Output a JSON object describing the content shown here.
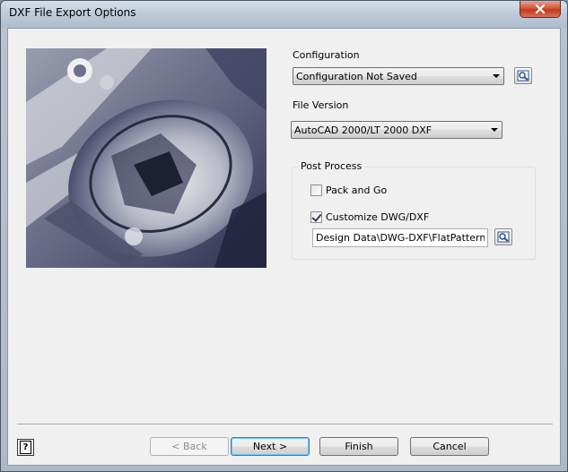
{
  "window": {
    "title": "DXF File Export Options"
  },
  "configuration": {
    "label": "Configuration",
    "selected": "Configuration Not Saved"
  },
  "file_version": {
    "label": "File Version",
    "selected": "AutoCAD 2000/LT 2000 DXF"
  },
  "post_process": {
    "title": "Post Process",
    "pack_and_go": {
      "label": "Pack and Go",
      "checked": false
    },
    "customize": {
      "label": "Customize DWG/DXF",
      "checked": true
    },
    "path_value": "Design Data\\DWG-DXF\\FlatPattern.xml"
  },
  "buttons": {
    "back": "< Back",
    "next": "Next >",
    "finish": "Finish",
    "cancel": "Cancel"
  },
  "help": {
    "glyph": "?"
  }
}
